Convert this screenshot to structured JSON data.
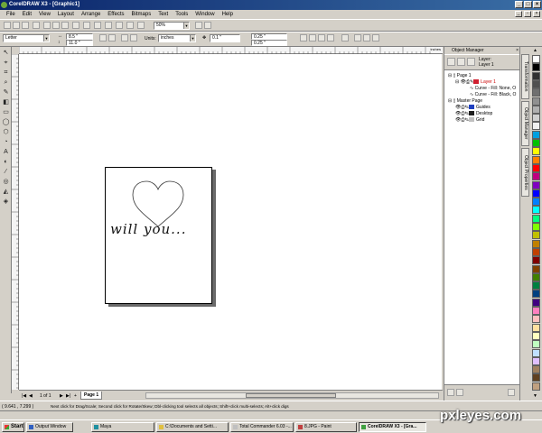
{
  "window": {
    "title": "CorelDRAW X3 - [Graphic1]"
  },
  "menu": [
    "File",
    "Edit",
    "View",
    "Layout",
    "Arrange",
    "Effects",
    "Bitmaps",
    "Text",
    "Tools",
    "Window",
    "Help"
  ],
  "toolbar": {
    "zoom": "50%"
  },
  "property_bar": {
    "paper_type": "Letter",
    "width": "8.5 \"",
    "height": "11.0 \"",
    "units_label": "Units:",
    "units": "inches",
    "nudge": "0.1 \"",
    "dup_x": "0.25 \"",
    "dup_y": "0.25 \""
  },
  "ruler": {
    "unit_label": "inches"
  },
  "canvas": {
    "artwork_text": "will you..."
  },
  "page_nav": {
    "counter": "1 of 1",
    "page_tab": "Page 1"
  },
  "object_manager": {
    "title": "Object Manager",
    "layer_header": [
      "Layer:",
      "Layer 1"
    ],
    "tree": [
      {
        "label": "Page 1",
        "level": 0
      },
      {
        "label": "Layer 1",
        "level": 1,
        "color": "#cc0000",
        "swatch": "#d02030"
      },
      {
        "label": "Curve - Fill: None, O",
        "level": 2
      },
      {
        "label": "Curve - Fill: Black, O",
        "level": 2
      },
      {
        "label": "Master Page",
        "level": 0
      },
      {
        "label": "Guides",
        "level": 1,
        "swatch": "#2040c0"
      },
      {
        "label": "Desktop",
        "level": 1,
        "swatch": "#202020"
      },
      {
        "label": "Grid",
        "level": 1,
        "swatch": "#c0c0c0"
      }
    ]
  },
  "side_tabs": [
    "Transformation",
    "Object Manager",
    "Object Properties"
  ],
  "palette": [
    "#ffffff",
    "#000000",
    "#303030",
    "#505050",
    "#707070",
    "#909090",
    "#b0b0b0",
    "#d0d0d0",
    "#f0f0f0",
    "#00a0e0",
    "#00c000",
    "#ffff00",
    "#ff8000",
    "#ff0000",
    "#c00080",
    "#8000c0",
    "#0000ff",
    "#0080ff",
    "#00ffff",
    "#00ff80",
    "#80ff00",
    "#c0c000",
    "#c08000",
    "#c04000",
    "#800000",
    "#804000",
    "#408000",
    "#008040",
    "#004080",
    "#400080",
    "#ff80c0",
    "#ffc0c0",
    "#ffe0a0",
    "#ffffc0",
    "#c0ffc0",
    "#c0e0ff",
    "#e0c0ff",
    "#a08060",
    "#604020",
    "#c0a080"
  ],
  "status": {
    "coords": "( 9.641 , 7.299 )",
    "hint": "Next click for Drag/Scale; Second click for Rotate/Skew; Dbl-clicking tool selects all objects; Shift+click multi-selects; Alt+click digs"
  },
  "taskbar": {
    "start": "Start",
    "items": [
      {
        "label": "Output Window",
        "color": "#3060c0"
      },
      {
        "label": "Maya",
        "color": "#2090a0"
      },
      {
        "label": "C:\\Documents and Setti...",
        "color": "#e0c040"
      },
      {
        "label": "Total Commander 6.03 -...",
        "color": "#c0c0c0"
      },
      {
        "label": "8.JPG - Paint",
        "color": "#c04040"
      },
      {
        "label": "CorelDRAW X3 - [Gra...",
        "color": "#40a040",
        "active": true
      }
    ]
  },
  "watermark": "pxleyes.com"
}
